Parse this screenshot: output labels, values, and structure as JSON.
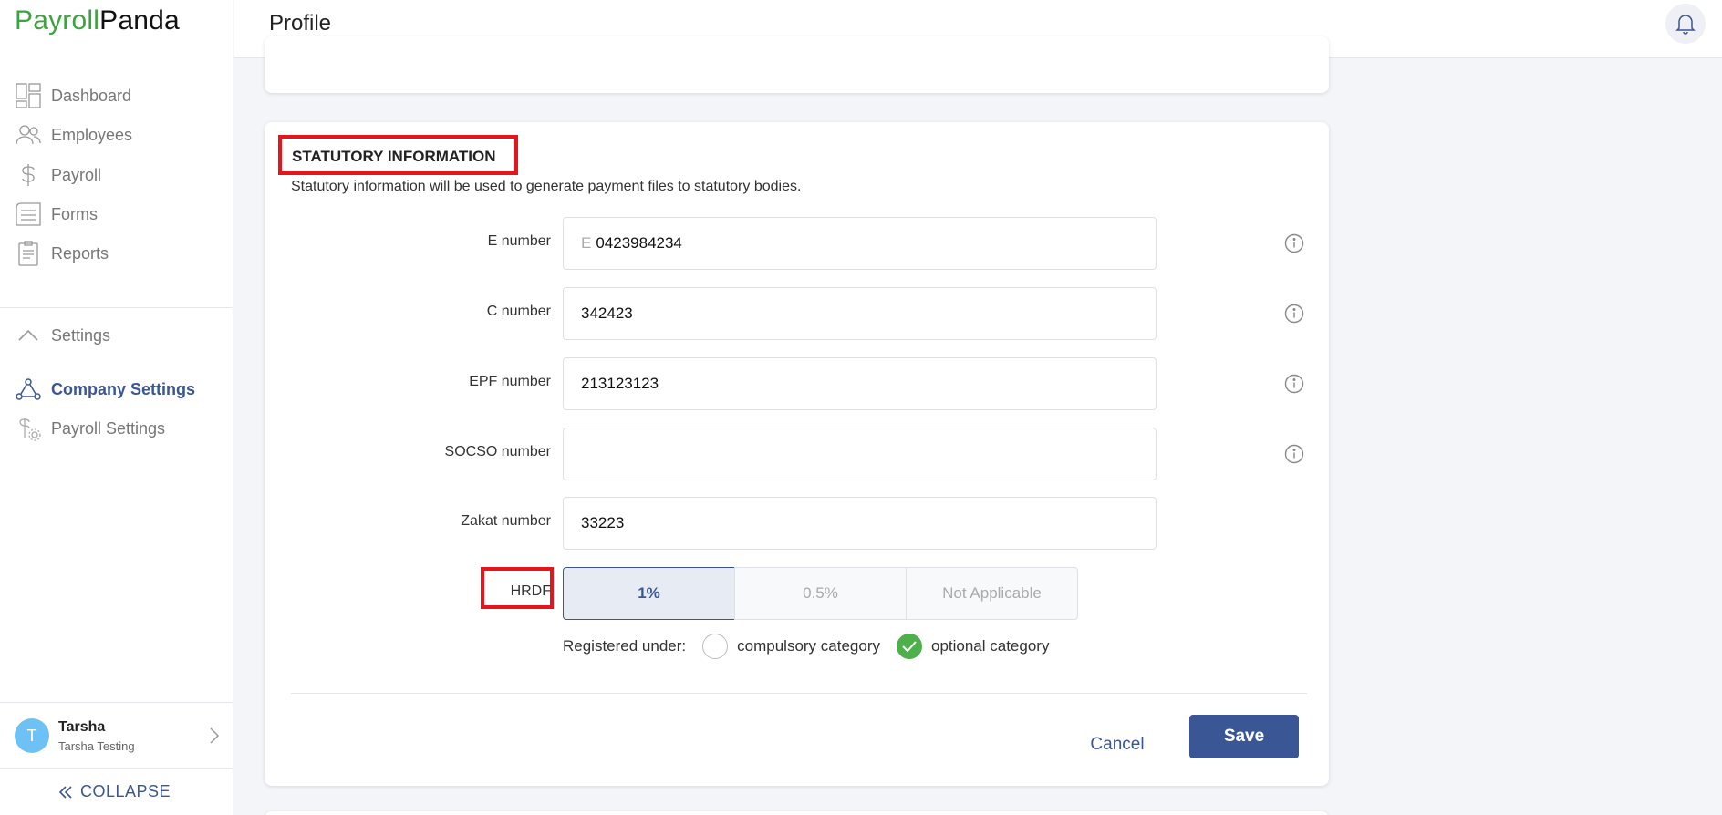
{
  "app": {
    "brand_part1": "Payroll",
    "brand_part2": "Panda"
  },
  "sidebar": {
    "items": [
      {
        "label": "Dashboard",
        "icon": "dashboard-icon"
      },
      {
        "label": "Employees",
        "icon": "employees-icon"
      },
      {
        "label": "Payroll",
        "icon": "dollar-icon"
      },
      {
        "label": "Forms",
        "icon": "forms-icon"
      },
      {
        "label": "Reports",
        "icon": "reports-icon"
      }
    ],
    "settings_label": "Settings",
    "settings_items": [
      {
        "label": "Company Settings",
        "icon": "company-icon",
        "active": true
      },
      {
        "label": "Payroll Settings",
        "icon": "payroll-settings-icon",
        "active": false
      }
    ],
    "user": {
      "initial": "T",
      "name": "Tarsha",
      "company": "Tarsha Testing"
    },
    "collapse_label": "COLLAPSE"
  },
  "header": {
    "title": "Profile",
    "notification_icon": "bell-icon"
  },
  "statutory": {
    "title": "STATUTORY INFORMATION",
    "description": "Statutory information will be used to generate payment files to statutory bodies.",
    "fields": [
      {
        "label": "E number",
        "prefix": "E",
        "value": "0423984234",
        "has_info": true
      },
      {
        "label": "C number",
        "value": "342423",
        "has_info": true
      },
      {
        "label": "EPF number",
        "value": "213123123",
        "has_info": true
      },
      {
        "label": "SOCSO number",
        "value": "",
        "has_info": true
      },
      {
        "label": "Zakat number",
        "value": "33223",
        "has_info": false
      }
    ],
    "hrdf": {
      "label": "HRDF",
      "options": [
        "1%",
        "0.5%",
        "Not Applicable"
      ],
      "selected": "1%",
      "registered_label": "Registered under:",
      "categories": [
        {
          "label": "compulsory category",
          "checked": false
        },
        {
          "label": "optional category",
          "checked": true
        }
      ]
    },
    "actions": {
      "cancel": "Cancel",
      "save": "Save"
    }
  },
  "colors": {
    "brand_green": "#3aa43f",
    "accent_blue": "#3a5694",
    "highlight_red": "#e8141c",
    "check_green": "#4db04a"
  }
}
